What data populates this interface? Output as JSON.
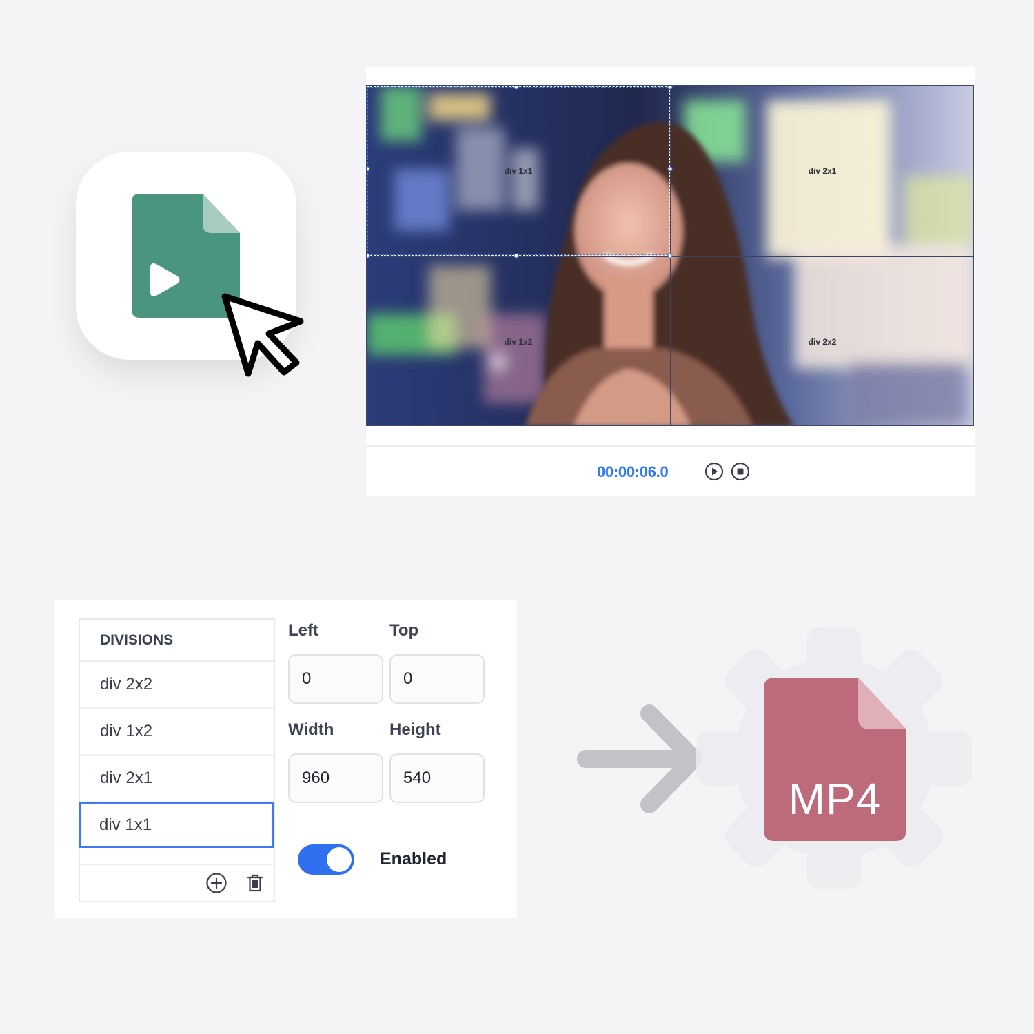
{
  "app_icon": {
    "name": "video-file-icon",
    "color": "#4a957f",
    "fold_color": "#a7cbbf"
  },
  "preview": {
    "timecode": "00:00:06.0",
    "divisions": [
      {
        "label": "div 1x1",
        "col": 1,
        "row": 1
      },
      {
        "label": "div 2x1",
        "col": 2,
        "row": 1
      },
      {
        "label": "div 1x2",
        "col": 1,
        "row": 2
      },
      {
        "label": "div 2x2",
        "col": 2,
        "row": 2
      }
    ],
    "selected_division": "div 1x1",
    "accent": "#2f7af2"
  },
  "divisions_panel": {
    "header": "DIVISIONS",
    "items": [
      "div 2x2",
      "div 1x2",
      "div 2x1",
      "div 1x1"
    ],
    "selected_index": 3,
    "fields": {
      "left_label": "Left",
      "left_value": "0",
      "top_label": "Top",
      "top_value": "0",
      "width_label": "Width",
      "width_value": "960",
      "height_label": "Height",
      "height_value": "540"
    },
    "toggle": {
      "on": true,
      "label": "Enabled",
      "color": "#2f6ff0"
    }
  },
  "output": {
    "format": "MP4",
    "file_color": "#bd6b7b",
    "fold_color": "#e0b0b9"
  }
}
